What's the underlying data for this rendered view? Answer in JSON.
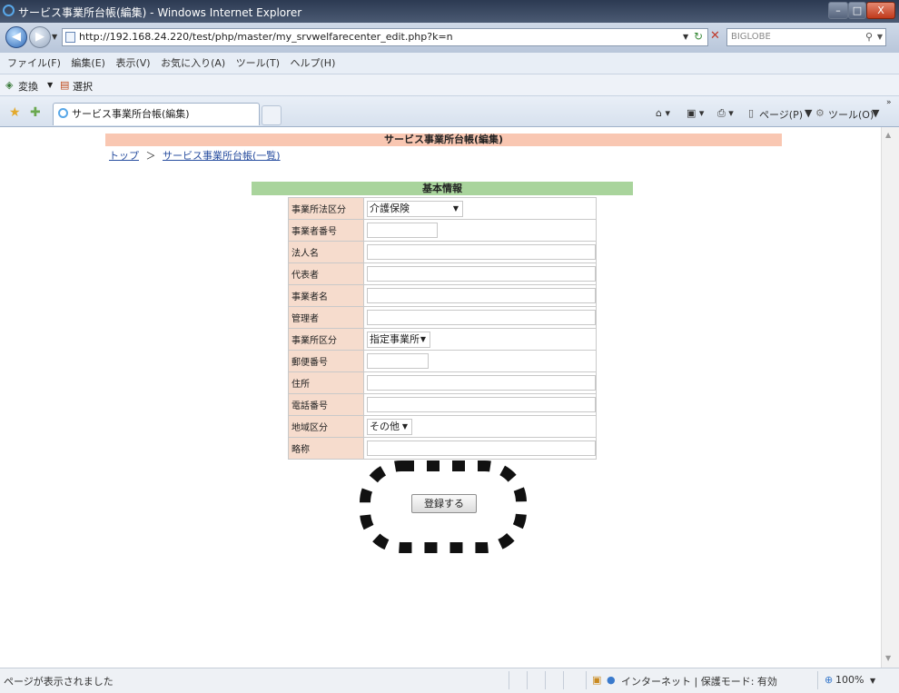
{
  "window": {
    "title": "サービス事業所台帳(編集) - Windows Internet Explorer"
  },
  "address": {
    "url": "http://192.168.24.220/test/php/master/my_srvwelfarecenter_edit.php?k=n",
    "search_placeholder": "BIGLOBE"
  },
  "menu": {
    "items": [
      "ファイル(F)",
      "編集(E)",
      "表示(V)",
      "お気に入り(A)",
      "ツール(T)",
      "ヘルプ(H)"
    ]
  },
  "toolbar2": {
    "convert_label": "変換",
    "select_label": "選択"
  },
  "tab": {
    "title": "サービス事業所台帳(編集)"
  },
  "commandbar": {
    "page_label": "ページ(P)",
    "tools_label": "ツール(O)"
  },
  "page": {
    "header": "サービス事業所台帳(編集)",
    "breadcrumb": {
      "top": "トップ",
      "separator": "＞",
      "list": "サービス事業所台帳(一覧)"
    },
    "section_title": "基本情報",
    "fields": [
      {
        "label": "事業所法区分",
        "type": "select",
        "value": "介護保険"
      },
      {
        "label": "事業者番号",
        "type": "text-short"
      },
      {
        "label": "法人名",
        "type": "text"
      },
      {
        "label": "代表者",
        "type": "text"
      },
      {
        "label": "事業者名",
        "type": "text"
      },
      {
        "label": "管理者",
        "type": "text"
      },
      {
        "label": "事業所区分",
        "type": "select",
        "value": "指定事業所"
      },
      {
        "label": "郵便番号",
        "type": "text-short"
      },
      {
        "label": "住所",
        "type": "text"
      },
      {
        "label": "電話番号",
        "type": "text"
      },
      {
        "label": "地域区分",
        "type": "select",
        "value": "その他"
      },
      {
        "label": "略称",
        "type": "text"
      }
    ],
    "submit_label": "登録する"
  },
  "status": {
    "left": "ページが表示されました",
    "zone": "インターネット | 保護モード: 有効",
    "zoom": "100%"
  },
  "colors": {
    "page_header_bg": "#f9c7b2",
    "section_header_bg": "#a9d49c",
    "label_bg": "#f6dccd"
  }
}
